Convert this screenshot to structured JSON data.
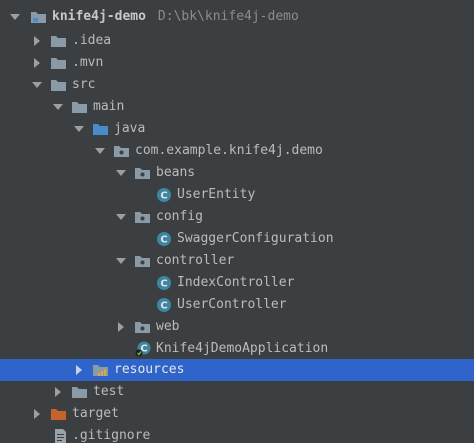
{
  "project_tree": {
    "root": {
      "name": "knife4j-demo",
      "path": "D:\\bk\\knife4j-demo"
    },
    "idea": ".idea",
    "mvn": ".mvn",
    "src": "src",
    "main": "main",
    "java": "java",
    "package": "com.example.knife4j.demo",
    "beans": "beans",
    "user_entity": "UserEntity",
    "config": "config",
    "swagger_configuration": "SwaggerConfiguration",
    "controller": "controller",
    "index_controller": "IndexController",
    "user_controller": "UserController",
    "web": "web",
    "application": "Knife4jDemoApplication",
    "resources": "resources",
    "test": "test",
    "target": "target",
    "gitignore": ".gitignore"
  },
  "colors": {
    "background": "#3c3f41",
    "selection": "#2f65ca",
    "folder": "#8a9aa6",
    "source_folder": "#4a8ccb",
    "excluded_folder": "#c5642a",
    "class_icon": "#3e86a0"
  }
}
